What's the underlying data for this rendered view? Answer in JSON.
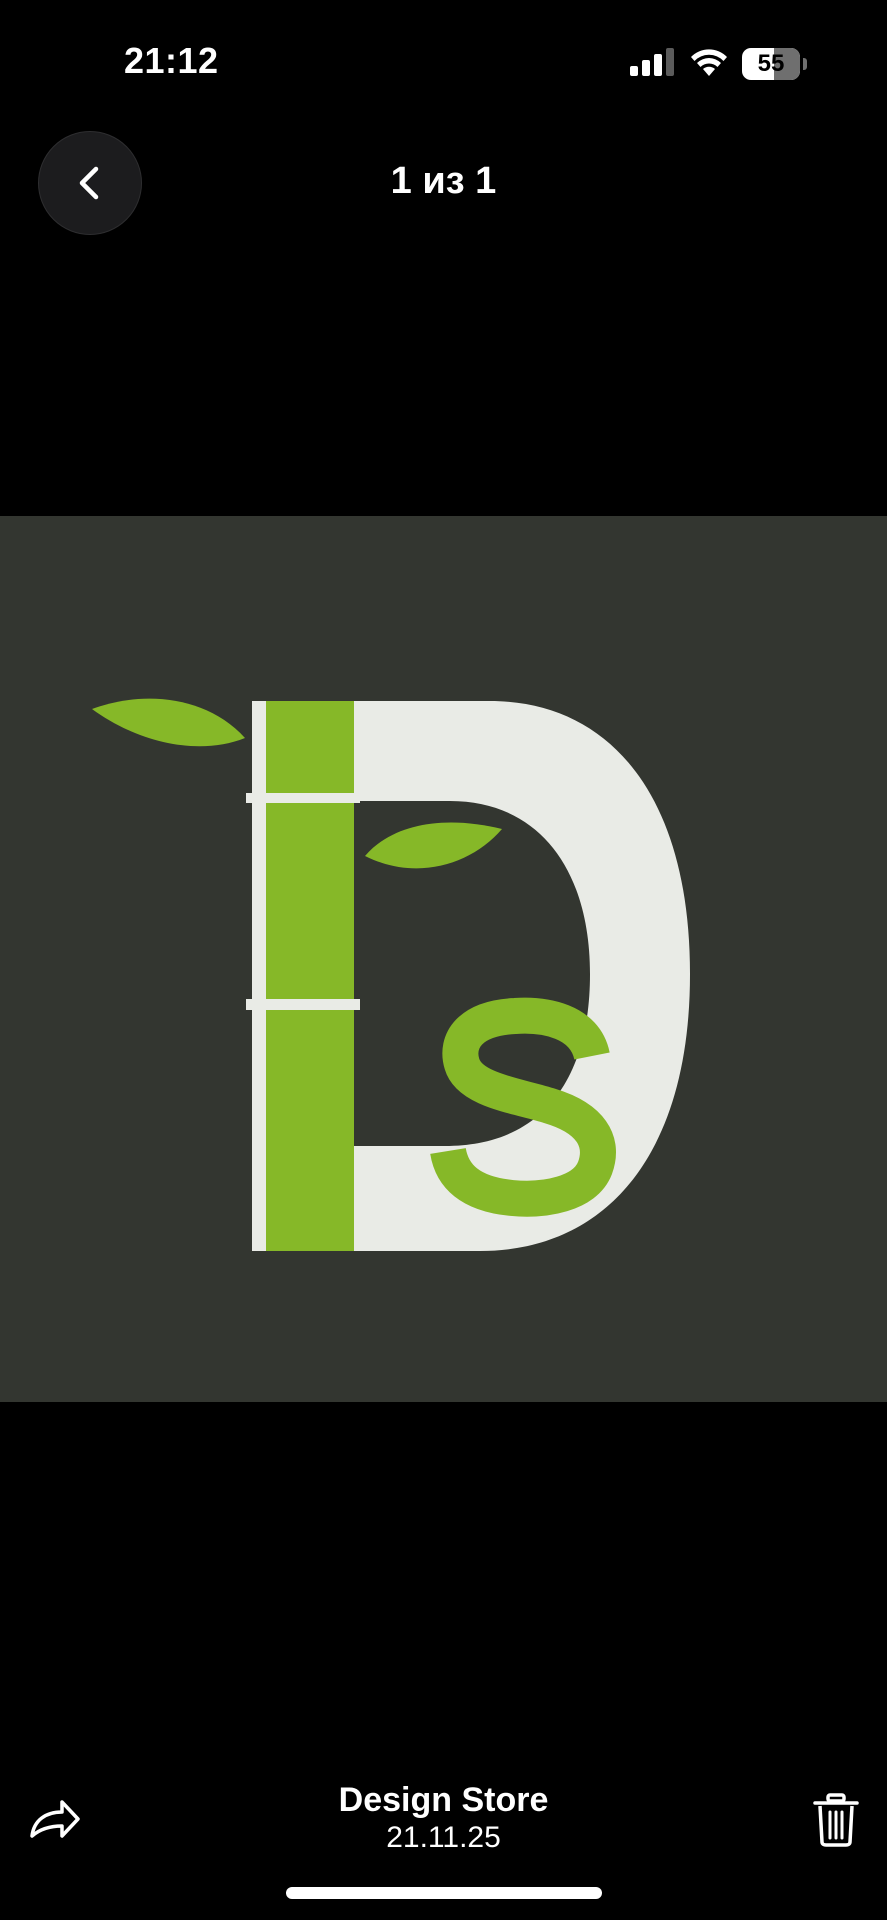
{
  "status_bar": {
    "time": "21:12",
    "battery_level": "55",
    "battery_fraction": 0.55
  },
  "header": {
    "back_icon": "chevron-left-icon",
    "counter": "1 из 1"
  },
  "photo": {
    "logo_text": "DS",
    "colors": {
      "background": "#333630",
      "green": "#86b828",
      "white": "#e9ebe6"
    }
  },
  "footer": {
    "share_icon": "share-arrow-icon",
    "title": "Design Store",
    "date": "21.11.25",
    "delete_icon": "trash-icon"
  }
}
